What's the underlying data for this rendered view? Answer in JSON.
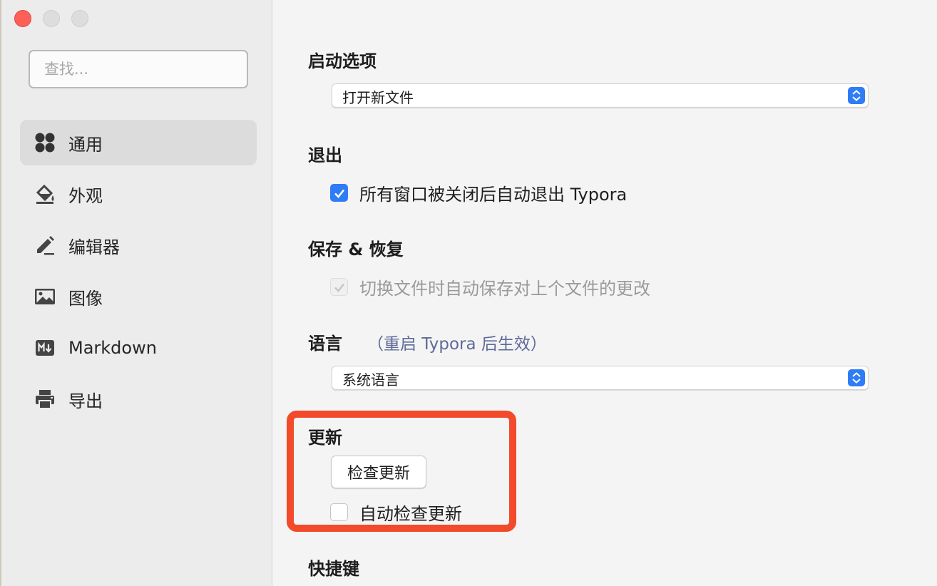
{
  "sidebar": {
    "search_placeholder": "查找...",
    "items": [
      {
        "label": "通用",
        "icon": "general-icon",
        "active": true
      },
      {
        "label": "外观",
        "icon": "paint-bucket-icon"
      },
      {
        "label": "编辑器",
        "icon": "pencil-icon"
      },
      {
        "label": "图像",
        "icon": "image-icon"
      },
      {
        "label": "Markdown",
        "icon": "markdown-icon"
      },
      {
        "label": "导出",
        "icon": "printer-icon"
      }
    ]
  },
  "main": {
    "startup": {
      "title": "启动选项",
      "value": "打开新文件"
    },
    "quit": {
      "title": "退出",
      "option": "所有窗口被关闭后自动退出 Typora",
      "checked": true
    },
    "save": {
      "title": "保存 & 恢复",
      "option": "切换文件时自动保存对上个文件的更改",
      "checked": true,
      "disabled": true
    },
    "language": {
      "title": "语言",
      "note": "（重启 Typora 后生效）",
      "value": "系统语言"
    },
    "update": {
      "title": "更新",
      "button": "检查更新",
      "option": "自动检查更新",
      "checked": false
    },
    "shortcuts": {
      "title": "快捷键"
    }
  },
  "colors": {
    "accent": "#2f7df6",
    "highlight": "#f24a2a",
    "note": "#5e6a99"
  }
}
